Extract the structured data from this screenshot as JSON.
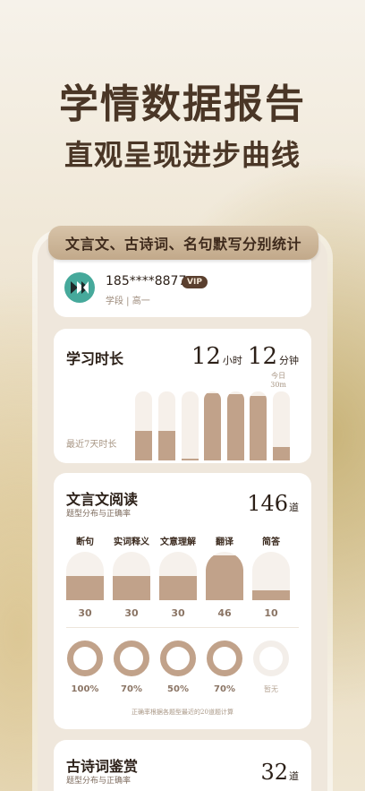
{
  "hero": {
    "title": "学情数据报告",
    "subtitle": "直观呈现进步曲线"
  },
  "banner": "文言文、古诗词、名句默写分别统计",
  "profile": {
    "phone": "185****8877",
    "vip": "VIP",
    "grade": "学段 | 高一"
  },
  "study_time": {
    "title": "学习时长",
    "hours": "12",
    "hours_unit": "小时",
    "minutes": "12",
    "minutes_unit": "分钟",
    "recent_label": "最近7天时长",
    "today_label": "今日",
    "today_value": "30m",
    "bars_fill": [
      0.43,
      0.43,
      0.02,
      0.97,
      0.96,
      0.93,
      0.19
    ]
  },
  "reading": {
    "title": "文言文阅读",
    "subtitle": "题型分布与正确率",
    "count": "146",
    "count_unit": "道",
    "categories": [
      {
        "name": "断句",
        "count": "30",
        "accuracy": "100%",
        "fill": 0.5
      },
      {
        "name": "实词释义",
        "count": "30",
        "accuracy": "70%",
        "fill": 0.5
      },
      {
        "name": "文意理解",
        "count": "30",
        "accuracy": "50%",
        "fill": 0.5
      },
      {
        "name": "翻译",
        "count": "46",
        "accuracy": "70%",
        "fill": 0.93
      },
      {
        "name": "简答",
        "count": "10",
        "accuracy": "暂无",
        "fill": 0.2
      }
    ],
    "note": "正确率根据各题型最近的20道题计算"
  },
  "poetry": {
    "title": "古诗词鉴赏",
    "subtitle": "题型分布与正确率",
    "count": "32",
    "count_unit": "道"
  },
  "colors": {
    "accent": "#c1a28a",
    "dark": "#5a3f2e",
    "avatar": "#46a99b"
  }
}
